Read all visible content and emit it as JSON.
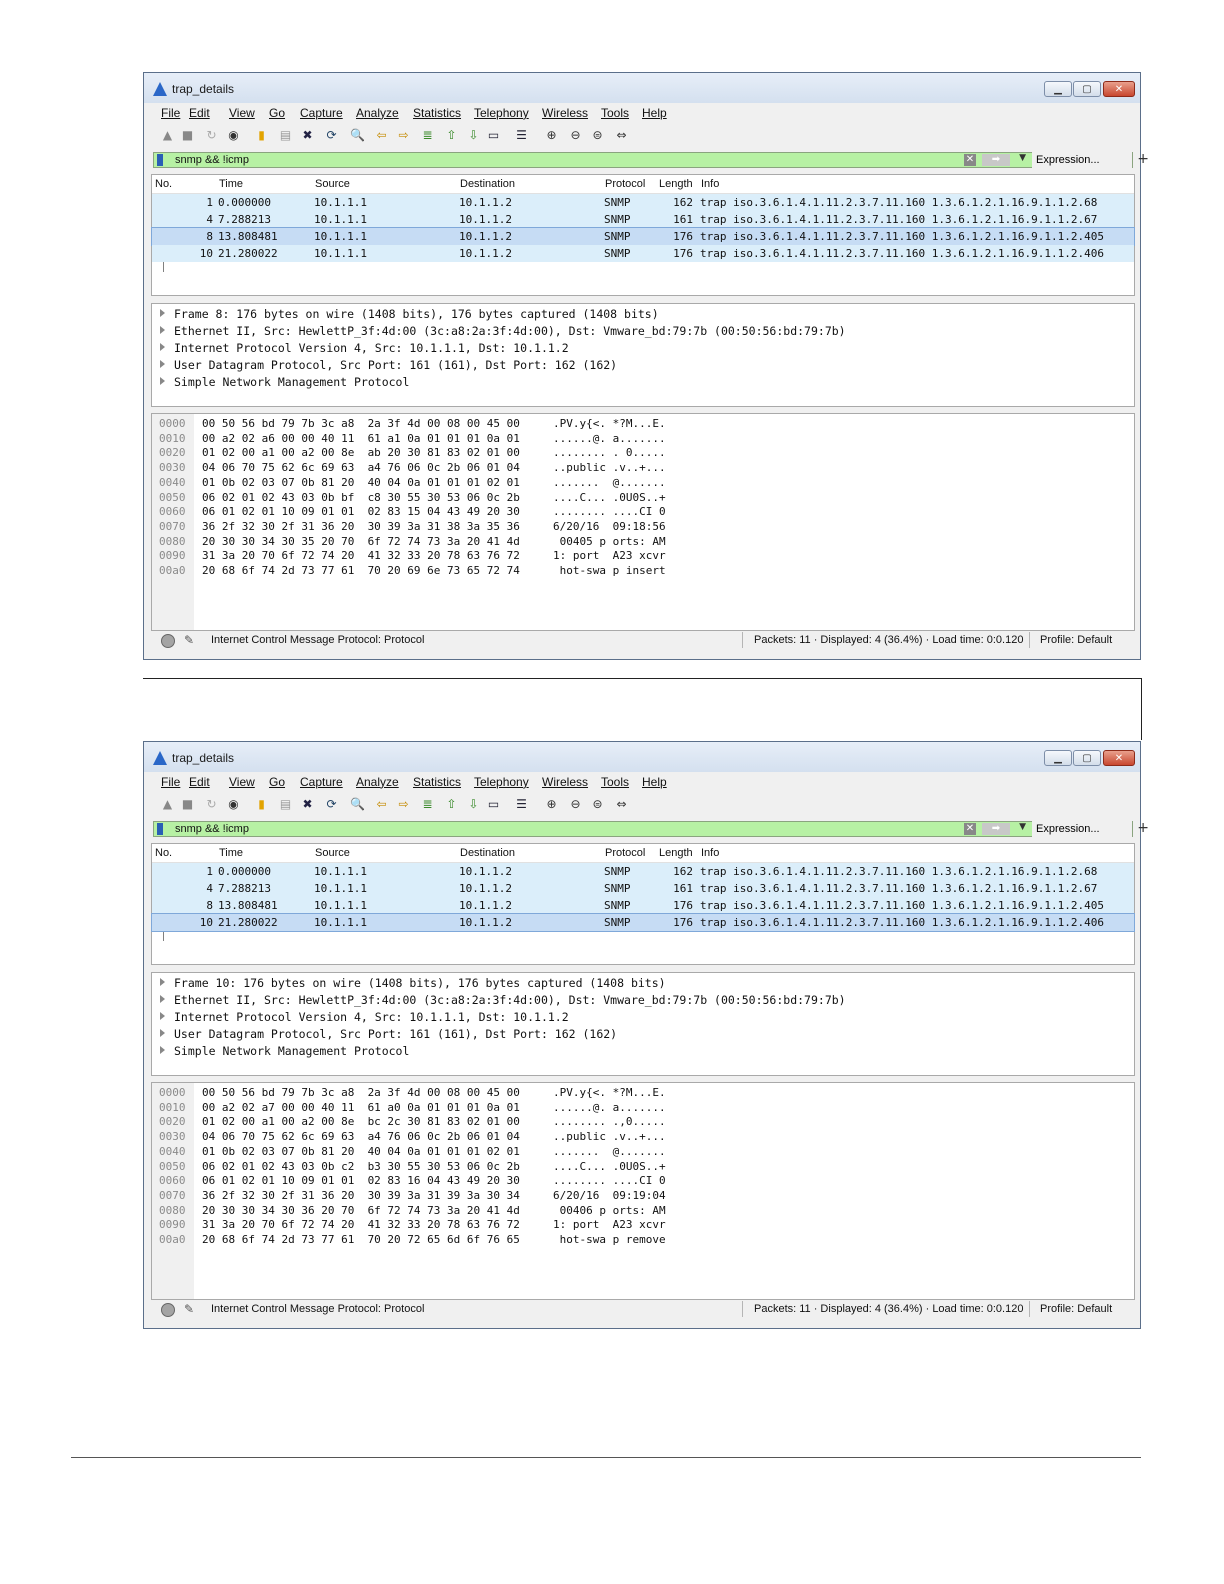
{
  "windows": [
    {
      "title": "trap_details",
      "menu": [
        "File",
        "Edit",
        "View",
        "Go",
        "Capture",
        "Analyze",
        "Statistics",
        "Telephony",
        "Wireless",
        "Tools",
        "Help"
      ],
      "filter": "snmp && !icmp",
      "expression_label": "Expression...",
      "plus_label": "+",
      "columns": [
        "No.",
        "Time",
        "Source",
        "Destination",
        "Protocol",
        "Length",
        "Info"
      ],
      "packets": [
        {
          "no": "1",
          "time": "0.000000",
          "src": "10.1.1.1",
          "dst": "10.1.1.2",
          "proto": "SNMP",
          "len": "162",
          "info": "trap iso.3.6.1.4.1.11.2.3.7.11.160 1.3.6.1.2.1.16.9.1.1.2.68"
        },
        {
          "no": "4",
          "time": "7.288213",
          "src": "10.1.1.1",
          "dst": "10.1.1.2",
          "proto": "SNMP",
          "len": "161",
          "info": "trap iso.3.6.1.4.1.11.2.3.7.11.160 1.3.6.1.2.1.16.9.1.1.2.67"
        },
        {
          "no": "8",
          "time": "13.808481",
          "src": "10.1.1.1",
          "dst": "10.1.1.2",
          "proto": "SNMP",
          "len": "176",
          "info": "trap iso.3.6.1.4.1.11.2.3.7.11.160 1.3.6.1.2.1.16.9.1.1.2.405"
        },
        {
          "no": "10",
          "time": "21.280022",
          "src": "10.1.1.1",
          "dst": "10.1.1.2",
          "proto": "SNMP",
          "len": "176",
          "info": "trap iso.3.6.1.4.1.11.2.3.7.11.160 1.3.6.1.2.1.16.9.1.1.2.406"
        }
      ],
      "selected_packet": 2,
      "details": [
        "Frame 8: 176 bytes on wire (1408 bits), 176 bytes captured (1408 bits)",
        "Ethernet II, Src: HewlettP_3f:4d:00 (3c:a8:2a:3f:4d:00), Dst: Vmware_bd:79:7b (00:50:56:bd:79:7b)",
        "Internet Protocol Version 4, Src: 10.1.1.1, Dst: 10.1.1.2",
        "User Datagram Protocol, Src Port: 161 (161), Dst Port: 162 (162)",
        "Simple Network Management Protocol"
      ],
      "bytes": [
        {
          "off": "0000",
          "hex": "00 50 56 bd 79 7b 3c a8  2a 3f 4d 00 08 00 45 00",
          "ascii": ".PV.y{<. *?M...E."
        },
        {
          "off": "0010",
          "hex": "00 a2 02 a6 00 00 40 11  61 a1 0a 01 01 01 0a 01",
          "ascii": "......@. a......."
        },
        {
          "off": "0020",
          "hex": "01 02 00 a1 00 a2 00 8e  ab 20 30 81 83 02 01 00",
          "ascii": "........ . 0....."
        },
        {
          "off": "0030",
          "hex": "04 06 70 75 62 6c 69 63  a4 76 06 0c 2b 06 01 04",
          "ascii": "..public .v..+..."
        },
        {
          "off": "0040",
          "hex": "01 0b 02 03 07 0b 81 20  40 04 0a 01 01 01 02 01",
          "ascii": ".......  @......."
        },
        {
          "off": "0050",
          "hex": "06 02 01 02 43 03 0b bf  c8 30 55 30 53 06 0c 2b",
          "ascii": "....C... .0U0S..+"
        },
        {
          "off": "0060",
          "hex": "06 01 02 01 10 09 01 01  02 83 15 04 43 49 20 30",
          "ascii": "........ ....CI 0"
        },
        {
          "off": "0070",
          "hex": "36 2f 32 30 2f 31 36 20  30 39 3a 31 38 3a 35 36",
          "ascii": "6/20/16  09:18:56"
        },
        {
          "off": "0080",
          "hex": "20 30 30 34 30 35 20 70  6f 72 74 73 3a 20 41 4d",
          "ascii": " 00405 p orts: AM"
        },
        {
          "off": "0090",
          "hex": "31 3a 20 70 6f 72 74 20  41 32 33 20 78 63 76 72",
          "ascii": "1: port  A23 xcvr"
        },
        {
          "off": "00a0",
          "hex": "20 68 6f 74 2d 73 77 61  70 20 69 6e 73 65 72 74",
          "ascii": " hot-swa p insert"
        }
      ],
      "status_text": "Internet Control Message Protocol: Protocol",
      "packets_text": "Packets: 11 · Displayed: 4 (36.4%) · Load time: 0:0.120",
      "profile_text": "Profile: Default"
    },
    {
      "title": "trap_details",
      "menu": [
        "File",
        "Edit",
        "View",
        "Go",
        "Capture",
        "Analyze",
        "Statistics",
        "Telephony",
        "Wireless",
        "Tools",
        "Help"
      ],
      "filter": "snmp && !icmp",
      "expression_label": "Expression...",
      "plus_label": "+",
      "columns": [
        "No.",
        "Time",
        "Source",
        "Destination",
        "Protocol",
        "Length",
        "Info"
      ],
      "packets": [
        {
          "no": "1",
          "time": "0.000000",
          "src": "10.1.1.1",
          "dst": "10.1.1.2",
          "proto": "SNMP",
          "len": "162",
          "info": "trap iso.3.6.1.4.1.11.2.3.7.11.160 1.3.6.1.2.1.16.9.1.1.2.68"
        },
        {
          "no": "4",
          "time": "7.288213",
          "src": "10.1.1.1",
          "dst": "10.1.1.2",
          "proto": "SNMP",
          "len": "161",
          "info": "trap iso.3.6.1.4.1.11.2.3.7.11.160 1.3.6.1.2.1.16.9.1.1.2.67"
        },
        {
          "no": "8",
          "time": "13.808481",
          "src": "10.1.1.1",
          "dst": "10.1.1.2",
          "proto": "SNMP",
          "len": "176",
          "info": "trap iso.3.6.1.4.1.11.2.3.7.11.160 1.3.6.1.2.1.16.9.1.1.2.405"
        },
        {
          "no": "10",
          "time": "21.280022",
          "src": "10.1.1.1",
          "dst": "10.1.1.2",
          "proto": "SNMP",
          "len": "176",
          "info": "trap iso.3.6.1.4.1.11.2.3.7.11.160 1.3.6.1.2.1.16.9.1.1.2.406"
        }
      ],
      "selected_packet": 3,
      "details": [
        "Frame 10: 176 bytes on wire (1408 bits), 176 bytes captured (1408 bits)",
        "Ethernet II, Src: HewlettP_3f:4d:00 (3c:a8:2a:3f:4d:00), Dst: Vmware_bd:79:7b (00:50:56:bd:79:7b)",
        "Internet Protocol Version 4, Src: 10.1.1.1, Dst: 10.1.1.2",
        "User Datagram Protocol, Src Port: 161 (161), Dst Port: 162 (162)",
        "Simple Network Management Protocol"
      ],
      "bytes": [
        {
          "off": "0000",
          "hex": "00 50 56 bd 79 7b 3c a8  2a 3f 4d 00 08 00 45 00",
          "ascii": ".PV.y{<. *?M...E."
        },
        {
          "off": "0010",
          "hex": "00 a2 02 a7 00 00 40 11  61 a0 0a 01 01 01 0a 01",
          "ascii": "......@. a......."
        },
        {
          "off": "0020",
          "hex": "01 02 00 a1 00 a2 00 8e  bc 2c 30 81 83 02 01 00",
          "ascii": "........ .,0....."
        },
        {
          "off": "0030",
          "hex": "04 06 70 75 62 6c 69 63  a4 76 06 0c 2b 06 01 04",
          "ascii": "..public .v..+..."
        },
        {
          "off": "0040",
          "hex": "01 0b 02 03 07 0b 81 20  40 04 0a 01 01 01 02 01",
          "ascii": ".......  @......."
        },
        {
          "off": "0050",
          "hex": "06 02 01 02 43 03 0b c2  b3 30 55 30 53 06 0c 2b",
          "ascii": "....C... .0U0S..+"
        },
        {
          "off": "0060",
          "hex": "06 01 02 01 10 09 01 01  02 83 16 04 43 49 20 30",
          "ascii": "........ ....CI 0"
        },
        {
          "off": "0070",
          "hex": "36 2f 32 30 2f 31 36 20  30 39 3a 31 39 3a 30 34",
          "ascii": "6/20/16  09:19:04"
        },
        {
          "off": "0080",
          "hex": "20 30 30 34 30 36 20 70  6f 72 74 73 3a 20 41 4d",
          "ascii": " 00406 p orts: AM"
        },
        {
          "off": "0090",
          "hex": "31 3a 20 70 6f 72 74 20  41 32 33 20 78 63 76 72",
          "ascii": "1: port  A23 xcvr"
        },
        {
          "off": "00a0",
          "hex": "20 68 6f 74 2d 73 77 61  70 20 72 65 6d 6f 76 65",
          "ascii": " hot-swa p remove"
        }
      ],
      "status_text": "Internet Control Message Protocol: Protocol",
      "packets_text": "Packets: 11 · Displayed: 4 (36.4%) · Load time: 0:0.120",
      "profile_text": "Profile: Default"
    }
  ],
  "colors": {
    "filter_bg": "#b7f1a4",
    "row_bg": "#dbeefa",
    "selected_row_bg": "#c6dcf4"
  },
  "toolbar_icons": [
    "shark-fin-start-icon",
    "stop-icon",
    "restart-icon",
    "capture-options-icon",
    "open-file-icon",
    "save-file-icon",
    "close-file-icon",
    "reload-icon",
    "find-icon",
    "back-icon",
    "forward-icon",
    "go-to-packet-icon",
    "first-packet-icon",
    "last-packet-icon",
    "autoscroll-icon",
    "colorize-icon",
    "zoom-in-icon",
    "zoom-out-icon",
    "normal-size-icon",
    "resize-columns-icon"
  ]
}
